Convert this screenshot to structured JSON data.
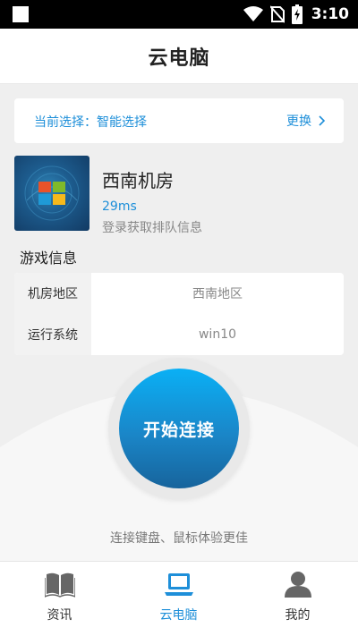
{
  "status_bar": {
    "time": "3:10",
    "icons": [
      "notification-square-icon",
      "wifi-icon",
      "no-sim-icon",
      "battery-charging-icon"
    ]
  },
  "header": {
    "title": "云电脑"
  },
  "selection": {
    "label": "当前选择：智能选择",
    "change_label": "更换"
  },
  "room": {
    "name": "西南机房",
    "ping": "29ms",
    "queue_hint": "登录获取排队信息",
    "thumbnail_icon": "windows-logo-icon"
  },
  "game_info": {
    "title": "游戏信息",
    "rows": [
      {
        "key": "机房地区",
        "value": "西南地区"
      },
      {
        "key": "运行系统",
        "value": "win10"
      }
    ]
  },
  "connect": {
    "label": "开始连接",
    "hint": "连接键盘、鼠标体验更佳"
  },
  "tabs": [
    {
      "label": "资讯",
      "icon": "book-icon",
      "active": false
    },
    {
      "label": "云电脑",
      "icon": "laptop-icon",
      "active": true
    },
    {
      "label": "我的",
      "icon": "user-icon",
      "active": false
    }
  ],
  "colors": {
    "accent": "#1e8fd9",
    "background": "#efefef",
    "connect_top": "#0ab0f5",
    "connect_bottom": "#17649c"
  }
}
